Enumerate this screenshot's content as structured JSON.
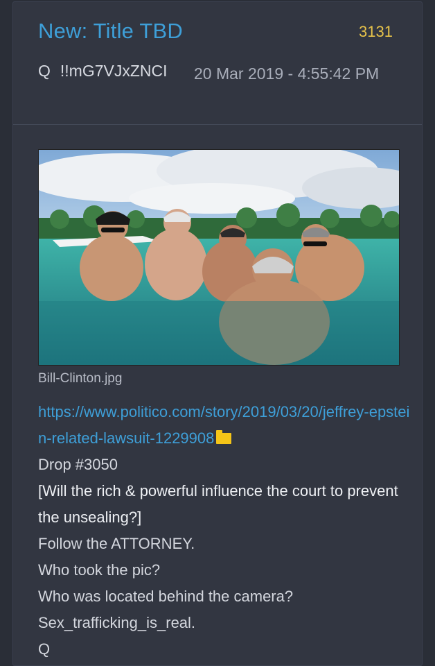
{
  "post": {
    "title": "New: Title TBD",
    "count": "3131",
    "author_q": "Q",
    "tripcode": "!!mG7VJxZNCI",
    "timestamp": "20 Mar 2019 - 4:55:42 PM"
  },
  "attachment": {
    "filename": "Bill-Clinton.jpg"
  },
  "body": {
    "link": "https://www.politico.com/story/2019/03/20/jeffrey-epstein-related-lawsuit-1229908",
    "lines": [
      "Drop #3050",
      "[Will the rich & powerful influence the court to prevent the unsealing?]",
      "Follow the ATTORNEY.",
      "Who took the pic?",
      "Who was located behind the camera?",
      "Sex_trafficking_is_real.",
      "Q"
    ]
  },
  "colors": {
    "title": "#3e9fd8",
    "count": "#e6c24a",
    "link": "#3e9fd8",
    "card_bg": "#323641",
    "page_bg": "#2a2e37"
  },
  "icons": {
    "link_suffix": "folder-icon"
  }
}
